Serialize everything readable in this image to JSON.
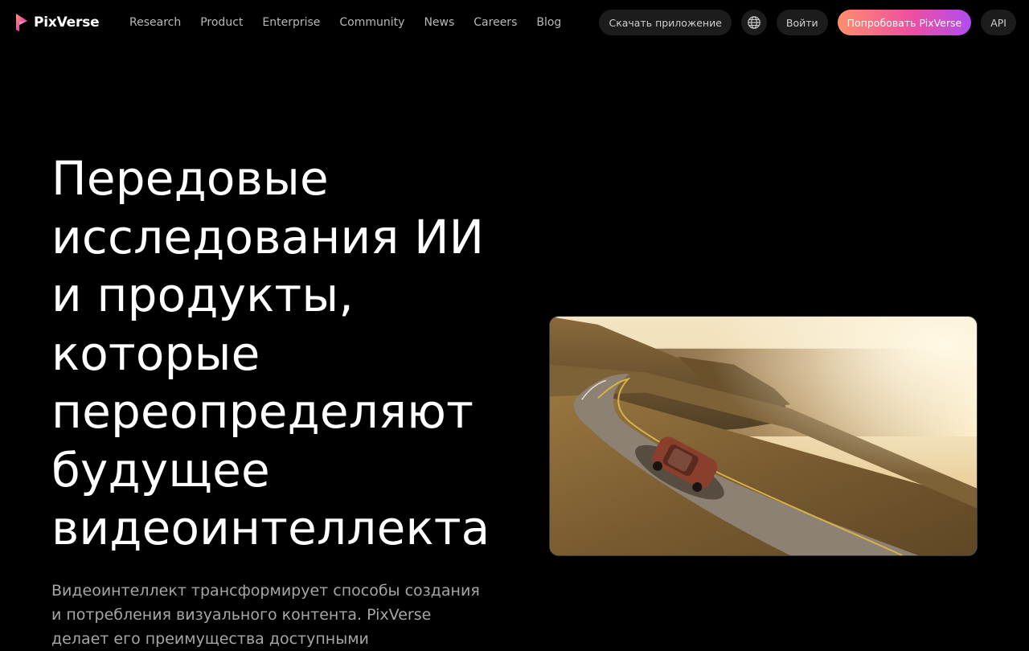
{
  "brand": {
    "name": "PixVerse",
    "colors": {
      "gradient_start": "#ff8f6b",
      "gradient_mid": "#ee4fa0",
      "gradient_end": "#b24cf0"
    }
  },
  "nav": {
    "links": [
      {
        "label": "Research"
      },
      {
        "label": "Product"
      },
      {
        "label": "Enterprise"
      },
      {
        "label": "Community"
      },
      {
        "label": "News"
      },
      {
        "label": "Careers"
      },
      {
        "label": "Blog"
      }
    ],
    "download_label": "Скачать приложение",
    "language_icon": "globe-icon",
    "login_label": "Войти",
    "try_label": "Попробовать PixVerse",
    "api_label": "API"
  },
  "hero": {
    "title": "Передовые исследования ИИ и продукты, которые переопределяют будущее видеоинтеллекта",
    "description": "Видеоинтеллект трансформирует способы создания и потребления визуального контента. PixVerse делает его преимущества доступными",
    "media": "coastal-road-car-video"
  }
}
